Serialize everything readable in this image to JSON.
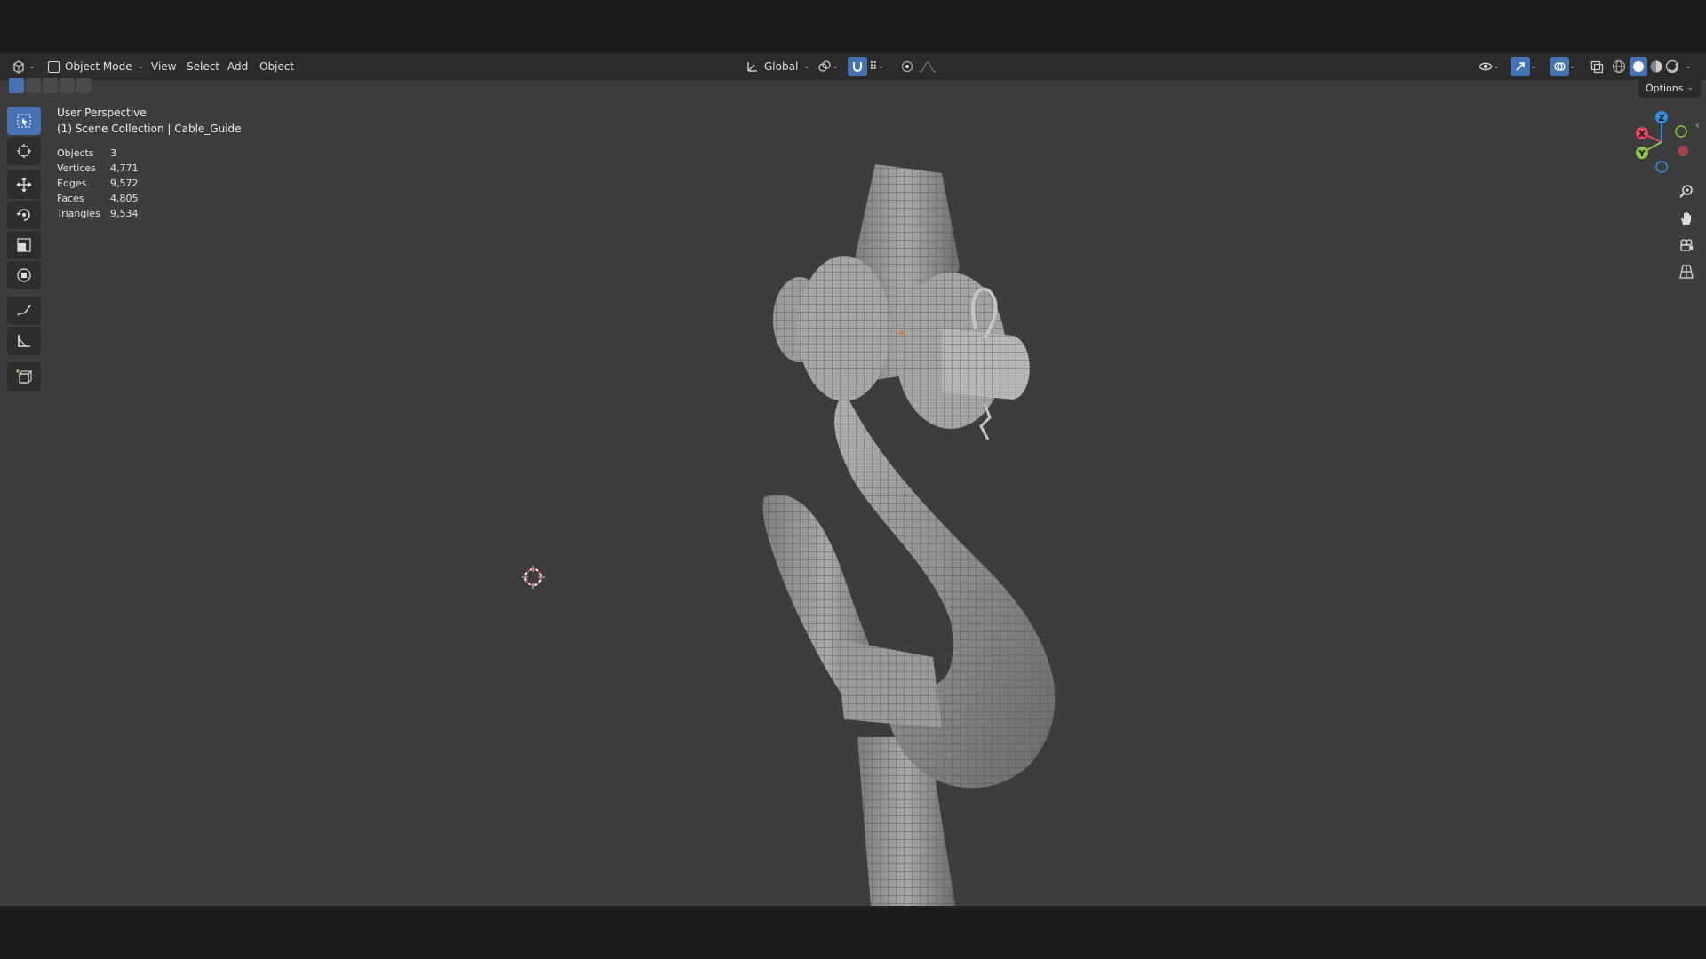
{
  "header": {
    "editor_type_icon": "3d-viewport-icon",
    "mode": "Object Mode",
    "menus": [
      "View",
      "Select",
      "Add",
      "Object"
    ],
    "orientation": "Global",
    "options": "Options"
  },
  "overlay": {
    "view_name": "User Perspective",
    "collection": "(1) Scene Collection | Cable_Guide",
    "stats": [
      {
        "label": "Objects",
        "value": "3"
      },
      {
        "label": "Vertices",
        "value": "4,771"
      },
      {
        "label": "Edges",
        "value": "9,572"
      },
      {
        "label": "Faces",
        "value": "4,805"
      },
      {
        "label": "Triangles",
        "value": "9,534"
      }
    ]
  },
  "gizmo": {
    "x": "X",
    "y": "Y",
    "z": "Z"
  },
  "tools": [
    "select-box-icon",
    "cursor-icon",
    "move-icon",
    "rotate-icon",
    "scale-icon",
    "transform-icon",
    "annotate-icon",
    "measure-icon",
    "add-cube-icon"
  ],
  "colors": {
    "accent": "#4772b3",
    "viewport_bg": "#3d3d3d",
    "header_bg": "#2b2b2b",
    "axis_x": "#e04a5f",
    "axis_y": "#8bc34a",
    "axis_z": "#2f8fe0"
  }
}
